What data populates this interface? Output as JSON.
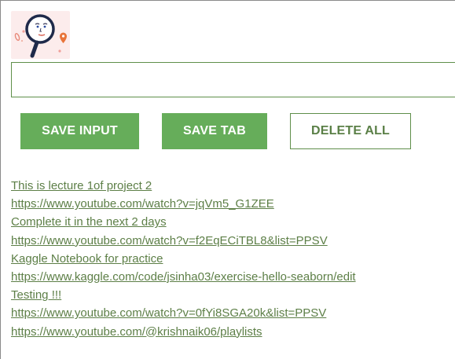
{
  "input": {
    "value": "",
    "placeholder": ""
  },
  "buttons": {
    "save_input": "SAVE INPUT",
    "save_tab": "SAVE TAB",
    "delete_all": "DELETE ALL"
  },
  "links": [
    "This is lecture 1of project 2",
    "https://www.youtube.com/watch?v=jqVm5_G1ZEE",
    "Complete it in the next 2 days",
    "https://www.youtube.com/watch?v=f2EqECiTBL8&list=PPSV",
    "Kaggle Notebook for practice",
    "https://www.kaggle.com/code/jsinha03/exercise-hello-seaborn/edit",
    "Testing !!!",
    "https://www.youtube.com/watch?v=0fYi8SGA20k&list=PPSV",
    "https://www.youtube.com/@krishnaik06/playlists"
  ],
  "colors": {
    "accent_green": "#66ad5a",
    "link_green": "#5d7f47",
    "border_green": "#5f8f4a",
    "logo_background": "#fcecec"
  },
  "icons": {
    "logo": "magnifying-glass-face-icon"
  }
}
